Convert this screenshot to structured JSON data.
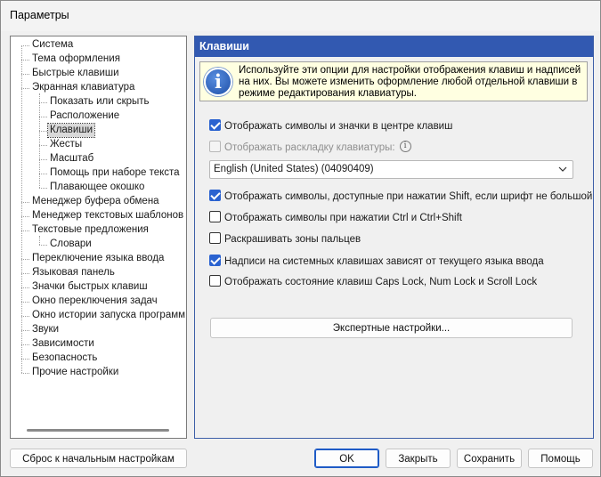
{
  "window": {
    "title": "Параметры"
  },
  "tree": {
    "items": [
      {
        "label": "Система",
        "level": 0
      },
      {
        "label": "Тема оформления",
        "level": 0
      },
      {
        "label": "Быстрые клавиши",
        "level": 0
      },
      {
        "label": "Экранная клавиатура",
        "level": 0
      },
      {
        "label": "Показать или скрыть",
        "level": 1
      },
      {
        "label": "Расположение",
        "level": 1
      },
      {
        "label": "Клавиши",
        "level": 1,
        "selected": true
      },
      {
        "label": "Жесты",
        "level": 1
      },
      {
        "label": "Масштаб",
        "level": 1
      },
      {
        "label": "Помощь при наборе текста",
        "level": 1
      },
      {
        "label": "Плавающее окошко",
        "level": 1
      },
      {
        "label": "Менеджер буфера обмена",
        "level": 0
      },
      {
        "label": "Менеджер текстовых шаблонов",
        "level": 0
      },
      {
        "label": "Текстовые предложения",
        "level": 0
      },
      {
        "label": "Словари",
        "level": 1
      },
      {
        "label": "Переключение языка ввода",
        "level": 0
      },
      {
        "label": "Языковая панель",
        "level": 0
      },
      {
        "label": "Значки быстрых клавиш",
        "level": 0
      },
      {
        "label": "Окно переключения задач",
        "level": 0
      },
      {
        "label": "Окно истории запуска программ",
        "level": 0
      },
      {
        "label": "Звуки",
        "level": 0
      },
      {
        "label": "Зависимости",
        "level": 0
      },
      {
        "label": "Безопасность",
        "level": 0
      },
      {
        "label": "Прочие настройки",
        "level": 0
      }
    ]
  },
  "panel": {
    "header": "Клавиши",
    "info_text": "Используйте эти опции для настройки отображения клавиш и надписей на них. Вы можете изменить оформление любой отдельной клавиши в режиме редактирования клавиатуры.",
    "options": [
      {
        "label": "Отображать символы и значки в центре клавиш",
        "checked": true,
        "disabled": false
      },
      {
        "label": "Отображать раскладку клавиатуры:",
        "checked": false,
        "disabled": true
      },
      {
        "label": "Отображать символы, доступные при нажатии Shift, если шрифт не большой",
        "checked": true,
        "disabled": false
      },
      {
        "label": "Отображать символы при нажатии Ctrl и Ctrl+Shift",
        "checked": false,
        "disabled": false
      },
      {
        "label": "Раскрашивать зоны пальцев",
        "checked": false,
        "disabled": false
      },
      {
        "label": "Надписи на системных клавишах зависят от текущего языка ввода",
        "checked": true,
        "disabled": false
      },
      {
        "label": "Отображать состояние клавиш Caps Lock, Num Lock и Scroll Lock",
        "checked": false,
        "disabled": false
      }
    ],
    "layout_select": {
      "value": "English (United States) (04090409)"
    },
    "expert_button": "Экспертные настройки..."
  },
  "footer": {
    "reset": "Сброс к начальным настройкам",
    "ok": "OK",
    "close": "Закрыть",
    "save": "Сохранить",
    "help": "Помощь"
  },
  "colors": {
    "header_bg": "#3259b1",
    "checkbox_checked": "#2a62d0",
    "info_bg": "#ffffe1"
  }
}
